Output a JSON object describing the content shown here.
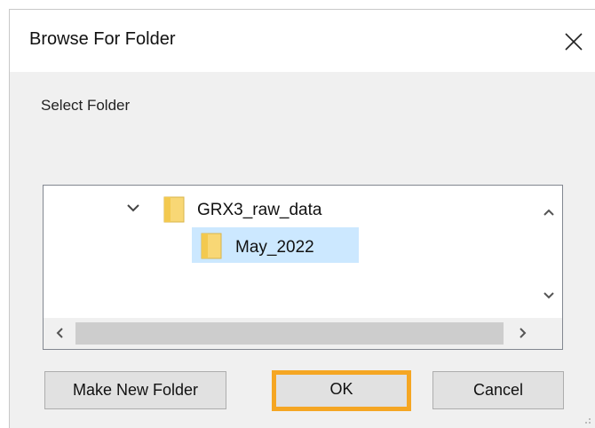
{
  "dialog": {
    "title": "Browse For Folder",
    "close_icon": "close-icon",
    "select_label": "Select Folder"
  },
  "tree": {
    "items": [
      {
        "label": "GRX3_raw_data",
        "expanded": true,
        "icon": "folder-icon",
        "selected": false
      },
      {
        "label": "May_2022",
        "expanded": false,
        "icon": "folder-icon",
        "selected": true
      }
    ]
  },
  "buttons": {
    "make_new_folder": "Make New Folder",
    "ok": "OK",
    "cancel": "Cancel"
  },
  "colors": {
    "highlight": "#f5a623",
    "selection": "#cce8ff",
    "folder": "#f8d775"
  }
}
